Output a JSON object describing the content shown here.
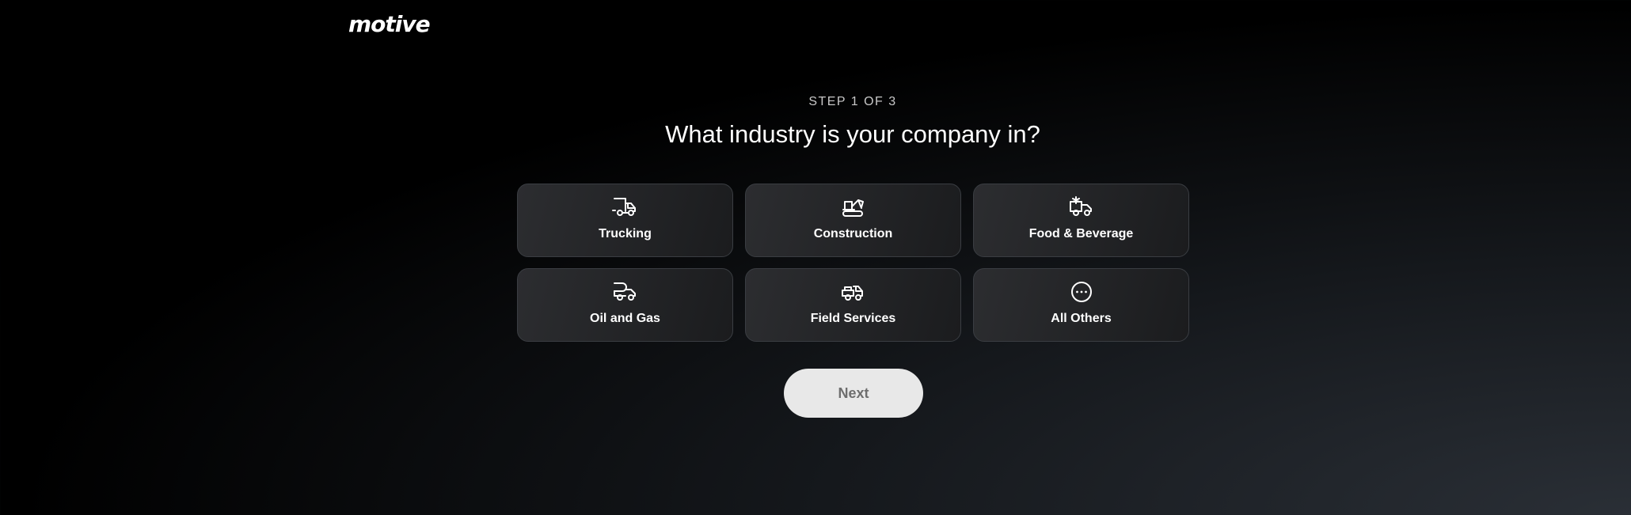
{
  "header": {
    "logo_text": "motive"
  },
  "main": {
    "step_label": "STEP 1 OF 3",
    "title": "What industry is your company in?",
    "options": [
      {
        "label": "Trucking",
        "icon": "truck-icon"
      },
      {
        "label": "Construction",
        "icon": "excavator-icon"
      },
      {
        "label": "Food & Beverage",
        "icon": "refrigerated-truck-icon"
      },
      {
        "label": "Oil and Gas",
        "icon": "tanker-truck-icon"
      },
      {
        "label": "Field Services",
        "icon": "service-truck-icon"
      },
      {
        "label": "All Others",
        "icon": "more-icon"
      }
    ],
    "next_label": "Next"
  },
  "colors": {
    "card_border": "#3a3d42",
    "button_bg": "#e8e8e8",
    "button_text": "#6e6e6e"
  }
}
